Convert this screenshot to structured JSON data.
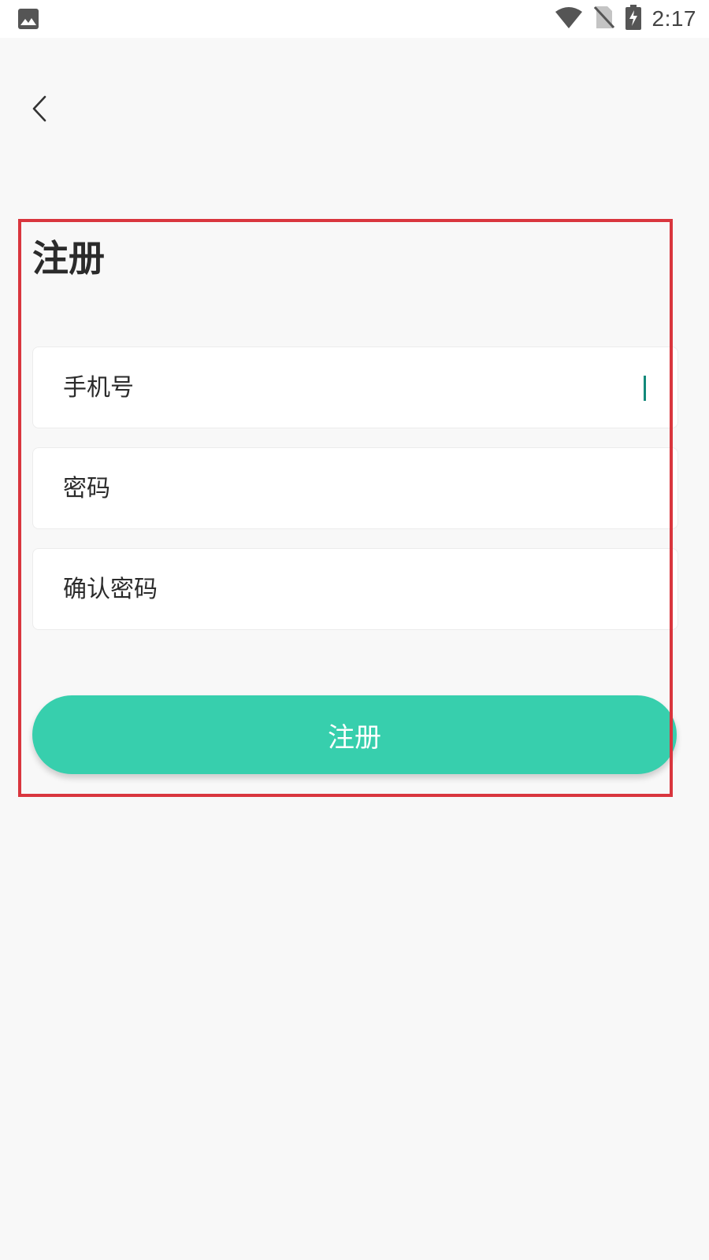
{
  "status_bar": {
    "time": "2:17",
    "icons": [
      "image-icon",
      "wifi-icon",
      "no-sim-icon",
      "battery-charging-icon"
    ]
  },
  "header": {
    "back_icon": "chevron-left-icon"
  },
  "form": {
    "title": "注册",
    "fields": [
      {
        "name": "phone",
        "placeholder": "手机号",
        "value": ""
      },
      {
        "name": "password",
        "placeholder": "密码",
        "value": ""
      },
      {
        "name": "confirm_password",
        "placeholder": "确认密码",
        "value": ""
      }
    ],
    "submit_label": "注册"
  },
  "colors": {
    "accent": "#37cfad",
    "cursor": "#12897a",
    "highlight_frame": "#d9363e",
    "background": "#f8f8f8"
  }
}
